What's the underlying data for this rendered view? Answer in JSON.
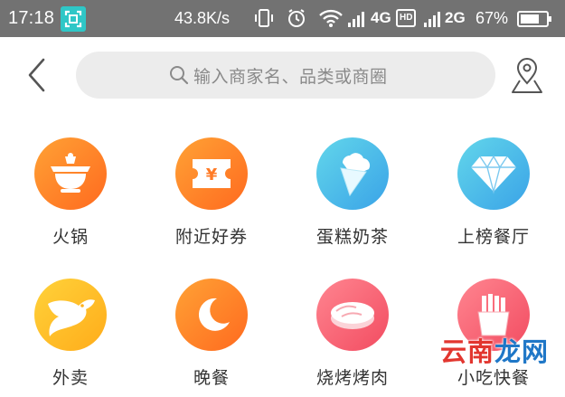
{
  "status_bar": {
    "time": "17:18",
    "net_speed": "43.8K/s",
    "network_1": "4G",
    "network_1_badge": "HD",
    "network_2": "2G",
    "battery": "67%",
    "icons": [
      "screenshot-scan-icon",
      "vibrate-icon",
      "alarm-icon",
      "wifi-icon",
      "signal-icon",
      "signal-icon",
      "battery-icon"
    ]
  },
  "header": {
    "back_icon": "chevron-left-icon",
    "search": {
      "placeholder": "输入商家名、品类或商圈",
      "icon": "search-icon"
    },
    "location_icon": "map-pin-icon"
  },
  "categories": [
    {
      "label": "火锅",
      "icon": "hotpot-icon",
      "color_from": "#ff9a2e",
      "color_to": "#ff6a1f"
    },
    {
      "label": "附近好券",
      "icon": "coupon-icon",
      "color_from": "#ff9a2e",
      "color_to": "#ff6a1f"
    },
    {
      "label": "蛋糕奶茶",
      "icon": "ice-cream-icon",
      "color_from": "#5fd0e8",
      "color_to": "#3aa7e8"
    },
    {
      "label": "上榜餐厅",
      "icon": "diamond-icon",
      "color_from": "#5fd0e8",
      "color_to": "#3aa7e8"
    },
    {
      "label": "外卖",
      "icon": "delivery-dog-icon",
      "color_from": "#ffc928",
      "color_to": "#ffae1a"
    },
    {
      "label": "晚餐",
      "icon": "moon-icon",
      "color_from": "#ff9a2e",
      "color_to": "#ff6a1f"
    },
    {
      "label": "烧烤烤肉",
      "icon": "meat-icon",
      "color_from": "#ff7d8a",
      "color_to": "#f24e62"
    },
    {
      "label": "小吃快餐",
      "icon": "fries-icon",
      "color_from": "#ff7d8a",
      "color_to": "#f24e62"
    }
  ],
  "watermark": {
    "part1": "云南",
    "part2": "龙网"
  }
}
